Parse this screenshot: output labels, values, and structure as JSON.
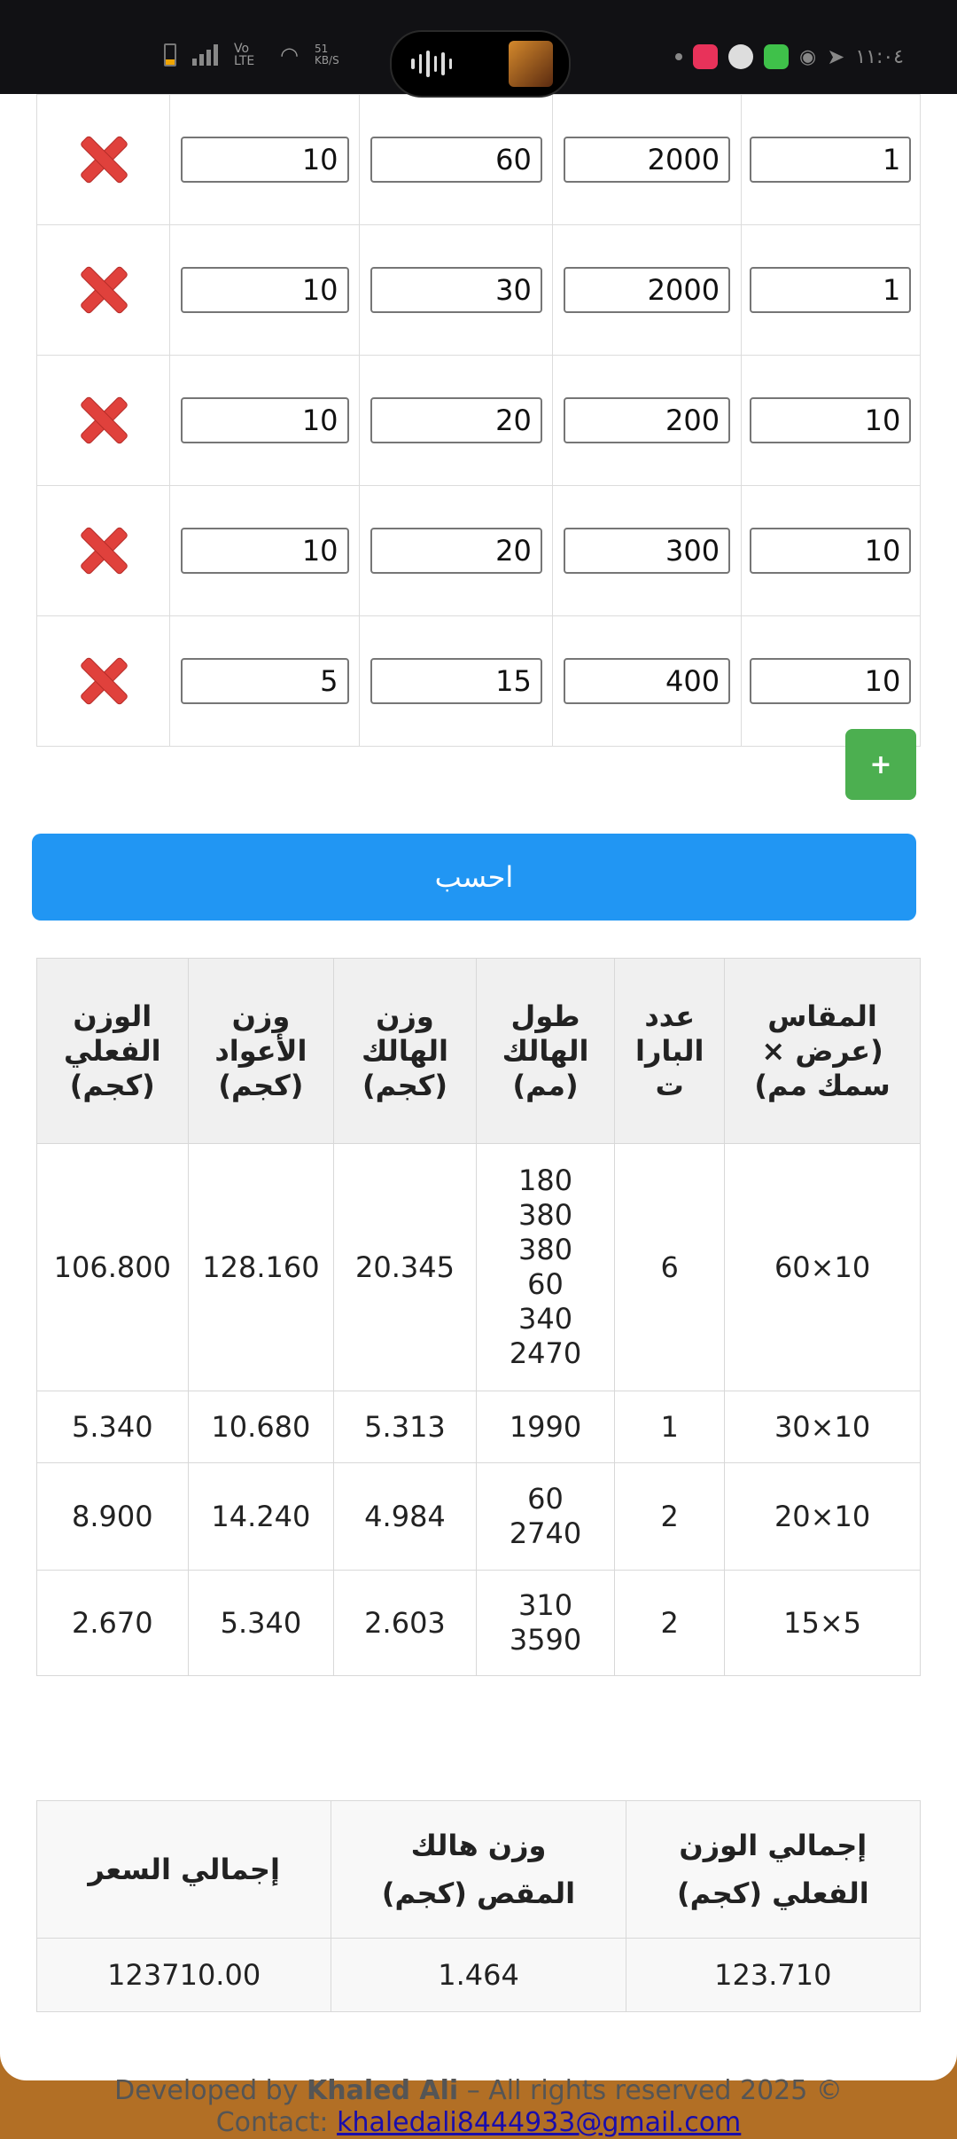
{
  "status_bar": {
    "time": "١١:٠٤",
    "network_left": "Vo LTE",
    "speed": "51 KB/S"
  },
  "input_rows": [
    {
      "c1": "10",
      "c2": "60",
      "c3": "2000",
      "c4": "1"
    },
    {
      "c1": "10",
      "c2": "30",
      "c3": "2000",
      "c4": "1"
    },
    {
      "c1": "10",
      "c2": "20",
      "c3": "200",
      "c4": "10"
    },
    {
      "c1": "10",
      "c2": "20",
      "c3": "300",
      "c4": "10"
    },
    {
      "c1": "5",
      "c2": "15",
      "c3": "400",
      "c4": "10"
    }
  ],
  "add_button": "+",
  "calculate_button": "احسب",
  "results": {
    "headers": [
      "المقاس (عرض × سمك مم)",
      "عدد البارا ت",
      "طول الهالك (مم)",
      "وزن الهالك (كجم)",
      "وزن الأعواد (كجم)",
      "الوزن الفعلي (كجم)"
    ],
    "rows": [
      {
        "size": "10×60",
        "bars": "6",
        "waste_length": [
          "180",
          "380",
          "380",
          "60",
          "340",
          "2470"
        ],
        "waste_weight": "20.345",
        "rods_weight": "128.160",
        "actual_weight": "106.800"
      },
      {
        "size": "10×30",
        "bars": "1",
        "waste_length": [
          "1990"
        ],
        "waste_weight": "5.313",
        "rods_weight": "10.680",
        "actual_weight": "5.340"
      },
      {
        "size": "10×20",
        "bars": "2",
        "waste_length": [
          "60",
          "2740"
        ],
        "waste_weight": "4.984",
        "rods_weight": "14.240",
        "actual_weight": "8.900"
      },
      {
        "size": "5×15",
        "bars": "2",
        "waste_length": [
          "310",
          "3590"
        ],
        "waste_weight": "2.603",
        "rods_weight": "5.340",
        "actual_weight": "2.670"
      }
    ]
  },
  "totals": {
    "headers": [
      "إجمالي الوزن الفعلي (كجم)",
      "وزن هالك المقص (كجم)",
      "إجمالي السعر"
    ],
    "values": [
      "123.710",
      "1.464",
      "123710.00"
    ]
  },
  "footer": {
    "developed_by": "Developed by",
    "author": "Khaled Ali",
    "rights": "– All rights reserved 2025 ©",
    "contact_label": "Contact:",
    "email": "khaledali8444933@gmail.com"
  }
}
